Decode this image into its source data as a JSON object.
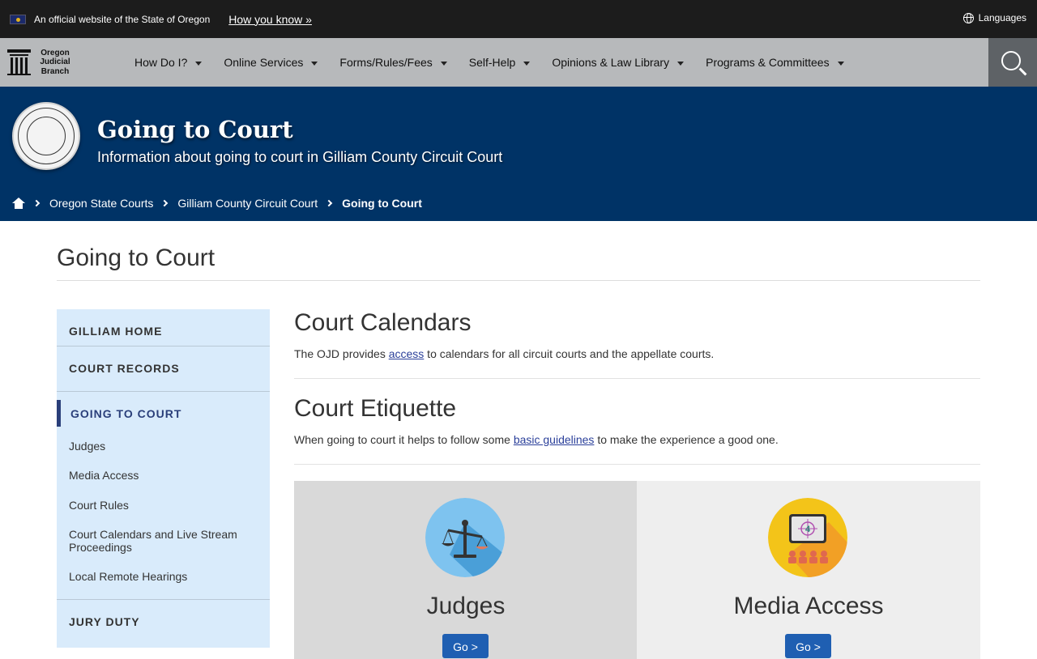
{
  "gov_banner": {
    "official_text": "An official website of the State of Oregon",
    "how_you_know": "How you know »",
    "languages": "Languages"
  },
  "logo": {
    "line1": "Oregon",
    "line2": "Judicial",
    "line3": "Branch"
  },
  "nav": {
    "items": [
      {
        "label": "How Do I?"
      },
      {
        "label": "Online Services"
      },
      {
        "label": "Forms/Rules/Fees"
      },
      {
        "label": "Self-Help"
      },
      {
        "label": "Opinions & Law Library"
      },
      {
        "label": "Programs & Committees"
      }
    ]
  },
  "hero": {
    "title": "Going to Court",
    "subtitle": "Information about going to court in Gilliam County Circuit Court"
  },
  "breadcrumb": {
    "items": [
      "Oregon State Courts",
      "Gilliam County Circuit Court"
    ],
    "current": "Going to Court"
  },
  "page": {
    "title": "Going to Court"
  },
  "sidebar": {
    "gilliam_home": "GILLIAM HOME",
    "court_records": "COURT RECORDS",
    "going_to_court": "GOING TO COURT",
    "links": [
      "Judges",
      "Media Access",
      "Court Rules",
      "Court Calendars and Live Stream Proceedings",
      "Local Remote Hearings"
    ],
    "jury_duty": "JURY DUTY"
  },
  "sections": {
    "calendars": {
      "title": "Court Calendars",
      "text_before": "The OJD provides ",
      "link": "access",
      "text_after": " to calendars for all circuit courts and the appellate courts."
    },
    "etiquette": {
      "title": "Court Etiquette",
      "text_before": "When going to court it helps to follow some ",
      "link": "basic guidelines",
      "text_after": " to make the experience a good one."
    }
  },
  "cards": {
    "judges": {
      "title": "Judges",
      "button": "Go >",
      "icon": "scales-icon"
    },
    "media": {
      "title": "Media Access",
      "button": "Go >",
      "icon": "presentation-screen-icon",
      "screen_number": "4"
    }
  },
  "colors": {
    "hero_bg": "#003366",
    "nav_bg": "#b7b9bb",
    "sidebar_bg": "#d9ebfb",
    "button_bg": "#1f5fb2"
  }
}
